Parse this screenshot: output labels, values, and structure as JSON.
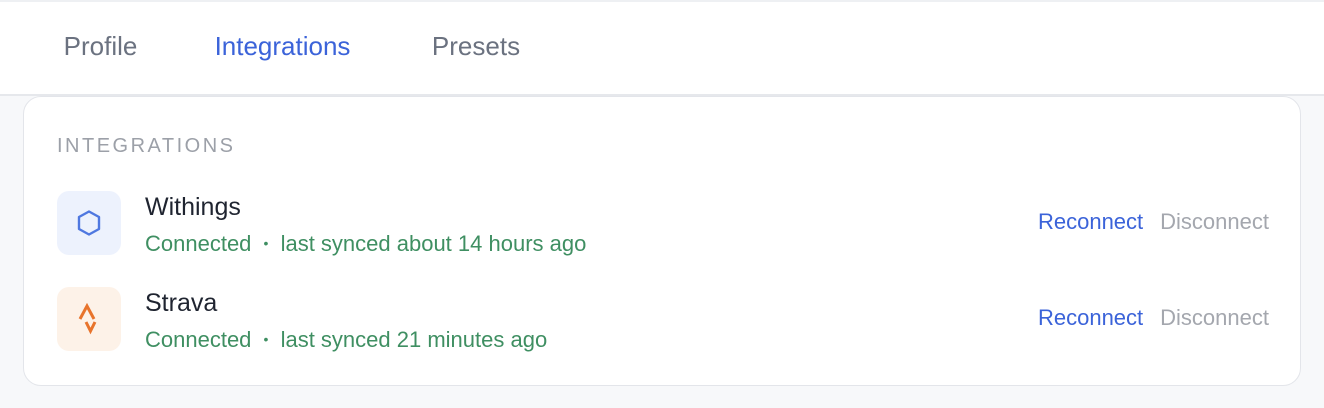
{
  "tabs": [
    {
      "label": "Profile",
      "active": false
    },
    {
      "label": "Integrations",
      "active": true
    },
    {
      "label": "Presets",
      "active": false
    }
  ],
  "section": {
    "title": "INTEGRATIONS"
  },
  "integrations": [
    {
      "name": "Withings",
      "icon": "withings-hexagon-icon",
      "status": "Connected",
      "separator": "•",
      "sync": "last synced about 14 hours ago",
      "reconnect_label": "Reconnect",
      "disconnect_label": "Disconnect"
    },
    {
      "name": "Strava",
      "icon": "strava-logo-icon",
      "status": "Connected",
      "separator": "•",
      "sync": "last synced 21 minutes ago",
      "reconnect_label": "Reconnect",
      "disconnect_label": "Disconnect"
    }
  ],
  "colors": {
    "accent": "#3b63d9",
    "connected": "#3f8f62",
    "muted": "#a4a7ae",
    "strava": "#e8742c"
  }
}
